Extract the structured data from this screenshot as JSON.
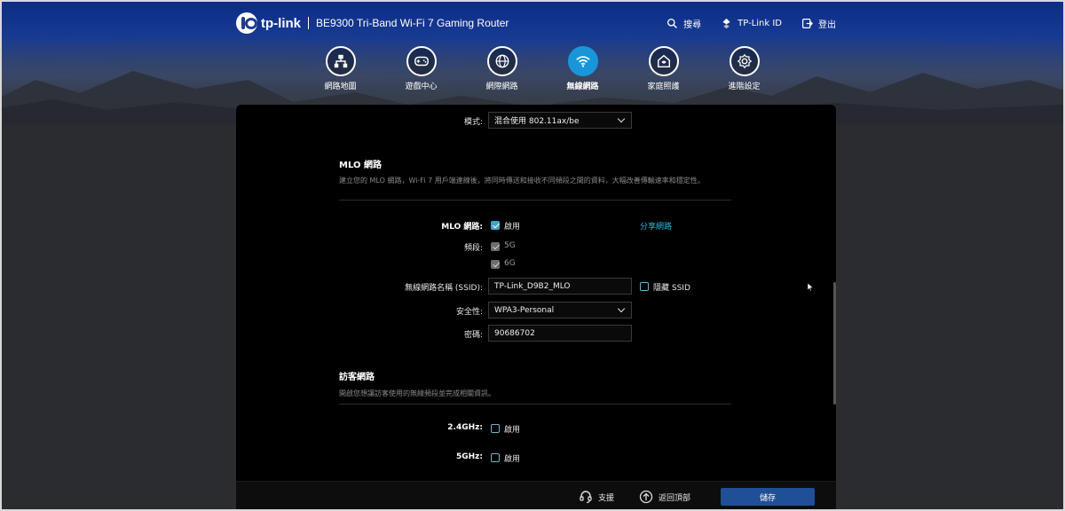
{
  "header": {
    "brand": "tp-link",
    "model": "BE9300 Tri-Band Wi-Fi 7 Gaming Router",
    "actions": [
      {
        "label": "搜尋",
        "icon": "search-icon"
      },
      {
        "label": "TP-Link ID",
        "icon": "tplink-id-icon"
      },
      {
        "label": "登出",
        "icon": "logout-icon"
      }
    ]
  },
  "nav": [
    {
      "label": "網路地圖",
      "icon": "network-map-icon",
      "active": false
    },
    {
      "label": "遊戲中心",
      "icon": "gamepad-icon",
      "active": false
    },
    {
      "label": "網際網路",
      "icon": "globe-icon",
      "active": false
    },
    {
      "label": "無線網路",
      "icon": "wifi-icon",
      "active": true
    },
    {
      "label": "家庭照護",
      "icon": "home-care-icon",
      "active": false
    },
    {
      "label": "進階設定",
      "icon": "gear-icon",
      "active": false
    }
  ],
  "mode": {
    "label": "模式:",
    "value": "混合使用 802.11ax/be"
  },
  "mlo": {
    "title": "MLO 網路",
    "description": "建立您的 MLO 網路，Wi-Fi 7 用戶端連線後，將同時傳送和接收不同頻段之間的資料，大幅改善傳輸速率和穩定性。",
    "network_label": "MLO 網路:",
    "enable_label": "啟用",
    "share_link": "分享網路",
    "band_label": "頻段:",
    "bands": [
      "5G",
      "6G"
    ],
    "ssid_label": "無線網路名稱 (SSID):",
    "ssid_value": "TP-Link_D9B2_MLO",
    "hide_ssid_label": "隱藏 SSID",
    "security_label": "安全性:",
    "security_value": "WPA3-Personal",
    "password_label": "密碼:",
    "password_value": "90686702"
  },
  "guest": {
    "title": "訪客網路",
    "description": "開啟您想讓訪客使用的無線頻段並完成相關資訊。",
    "band_24_label": "2.4GHz:",
    "band_5_label": "5GHz:",
    "enable_label": "啟用"
  },
  "footer": {
    "support": "支援",
    "back_to_top": "返回頂部",
    "save": "儲存"
  },
  "colors": {
    "accent": "#1996d8",
    "save_button": "#1f4f97",
    "link": "#2fb3e3"
  }
}
